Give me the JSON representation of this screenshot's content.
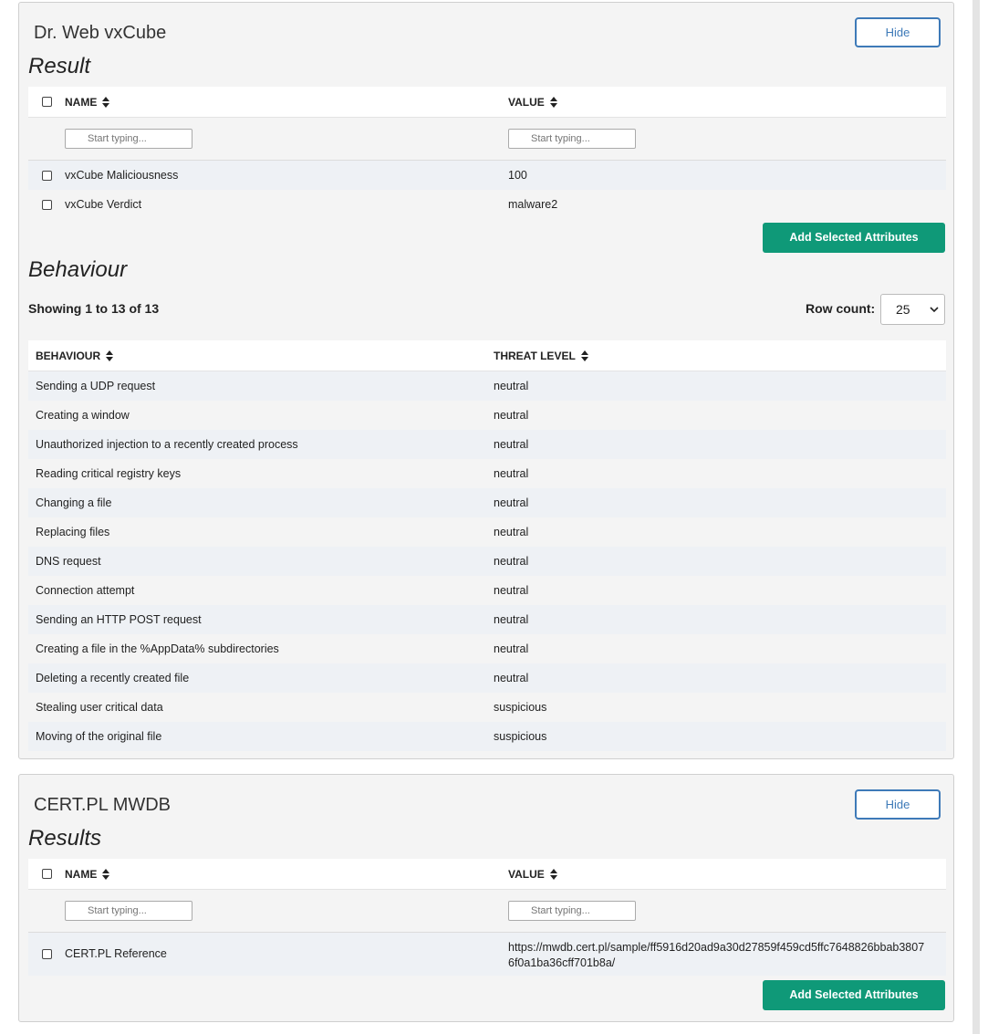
{
  "vxcube": {
    "title": "Dr. Web vxCube",
    "hide_label": "Hide",
    "result_title": "Result",
    "columns": {
      "name": "NAME",
      "value": "VALUE"
    },
    "filter_placeholder": "Start typing...",
    "rows": [
      {
        "name": "vxCube Maliciousness",
        "value": "100"
      },
      {
        "name": "vxCube Verdict",
        "value": "malware2"
      }
    ],
    "add_label": "Add Selected Attributes",
    "behaviour_title": "Behaviour",
    "showing": "Showing 1 to 13 of 13",
    "row_count_label": "Row count:",
    "row_count_value": "25",
    "behaviour_columns": {
      "behaviour": "BEHAVIOUR",
      "threat": "THREAT LEVEL"
    },
    "behaviours": [
      {
        "behaviour": "Sending a UDP request",
        "threat": "neutral"
      },
      {
        "behaviour": "Creating a window",
        "threat": "neutral"
      },
      {
        "behaviour": "Unauthorized injection to a recently created process",
        "threat": "neutral"
      },
      {
        "behaviour": "Reading critical registry keys",
        "threat": "neutral"
      },
      {
        "behaviour": "Changing a file",
        "threat": "neutral"
      },
      {
        "behaviour": "Replacing files",
        "threat": "neutral"
      },
      {
        "behaviour": "DNS request",
        "threat": "neutral"
      },
      {
        "behaviour": "Connection attempt",
        "threat": "neutral"
      },
      {
        "behaviour": "Sending an HTTP POST request",
        "threat": "neutral"
      },
      {
        "behaviour": "Creating a file in the %AppData% subdirectories",
        "threat": "neutral"
      },
      {
        "behaviour": "Deleting a recently created file",
        "threat": "neutral"
      },
      {
        "behaviour": "Stealing user critical data",
        "threat": "suspicious"
      },
      {
        "behaviour": "Moving of the original file",
        "threat": "suspicious"
      }
    ]
  },
  "mwdb": {
    "title": "CERT.PL MWDB",
    "hide_label": "Hide",
    "result_title": "Results",
    "columns": {
      "name": "NAME",
      "value": "VALUE"
    },
    "filter_placeholder": "Start typing...",
    "rows": [
      {
        "name": "CERT.PL Reference",
        "value": "https://mwdb.cert.pl/sample/ff5916d20ad9a30d27859f459cd5ffc7648826bbab38076f0a1ba36cff701b8a/"
      }
    ],
    "add_label": "Add Selected Attributes"
  },
  "icons": [
    "sort-icon",
    "search-icon",
    "checkbox-icon",
    "chevron-down-icon"
  ],
  "colors": {
    "accent_green": "#0f9978",
    "hide_blue": "#3e7ab8",
    "alt_row": "#eef1f5"
  }
}
